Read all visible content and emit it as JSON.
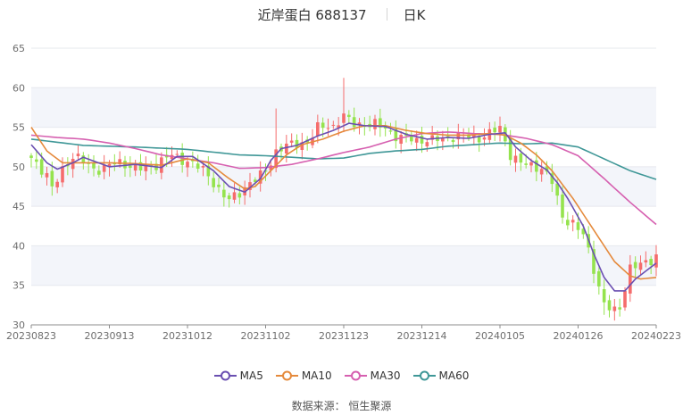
{
  "header": {
    "name_code": "近岸蛋白 688137",
    "period": "日K"
  },
  "source": "数据来源： 恒生聚源",
  "chart_data": {
    "type": "candlestick",
    "y_ticks": [
      30,
      35,
      40,
      45,
      50,
      55,
      60,
      65
    ],
    "ylim": [
      30,
      65
    ],
    "x_tick_labels": [
      "20230823",
      "20230913",
      "20231012",
      "20231102",
      "20231123",
      "20231214",
      "20240105",
      "20240126",
      "20240223"
    ],
    "x_tick_index": [
      0,
      15,
      30,
      45,
      60,
      75,
      90,
      105,
      120
    ],
    "n_days": 121,
    "colors": {
      "up": "#f56c6c",
      "down": "#95e34e",
      "MA5": "#6a4fb1",
      "MA10": "#e58a3c",
      "MA30": "#d660b0",
      "MA60": "#3f9797"
    },
    "legend": [
      "MA5",
      "MA10",
      "MA30",
      "MA60"
    ],
    "close_knots": [
      [
        0,
        50.8
      ],
      [
        3,
        49
      ],
      [
        4,
        47.5
      ],
      [
        6,
        49.8
      ],
      [
        8,
        51
      ],
      [
        12,
        50
      ],
      [
        18,
        50.2
      ],
      [
        24,
        50
      ],
      [
        27,
        51.5
      ],
      [
        30,
        51
      ],
      [
        35,
        48
      ],
      [
        38,
        46
      ],
      [
        40,
        46.5
      ],
      [
        43,
        48.3
      ],
      [
        45,
        49.8
      ],
      [
        47,
        52
      ],
      [
        50,
        52.5
      ],
      [
        53,
        53.5
      ],
      [
        55,
        55
      ],
      [
        58,
        54.8
      ],
      [
        60,
        56.5
      ],
      [
        62,
        55.8
      ],
      [
        65,
        55
      ],
      [
        68,
        55
      ],
      [
        71,
        53.8
      ],
      [
        74,
        53
      ],
      [
        78,
        53.8
      ],
      [
        82,
        53.5
      ],
      [
        86,
        54
      ],
      [
        90,
        54.5
      ],
      [
        92,
        51.5
      ],
      [
        95,
        50.5
      ],
      [
        98,
        49.5
      ],
      [
        100,
        48
      ],
      [
        102,
        44
      ],
      [
        104,
        43
      ],
      [
        106,
        41
      ],
      [
        110,
        33
      ],
      [
        112,
        31.8
      ],
      [
        113,
        32
      ],
      [
        115,
        37
      ],
      [
        118,
        38
      ],
      [
        120,
        39
      ]
    ],
    "ma5_knots": [
      [
        0,
        52.8
      ],
      [
        3,
        50.5
      ],
      [
        5,
        49.7
      ],
      [
        8,
        50.5
      ],
      [
        10,
        51.2
      ],
      [
        15,
        50
      ],
      [
        20,
        50.3
      ],
      [
        25,
        49.9
      ],
      [
        28,
        51.3
      ],
      [
        31,
        51.3
      ],
      [
        35,
        49.5
      ],
      [
        38,
        47.5
      ],
      [
        41,
        46.8
      ],
      [
        44,
        48.5
      ],
      [
        46,
        50.8
      ],
      [
        48,
        52.3
      ],
      [
        51,
        52.7
      ],
      [
        55,
        53.9
      ],
      [
        58,
        54.6
      ],
      [
        61,
        55.5
      ],
      [
        64,
        55.2
      ],
      [
        68,
        55.1
      ],
      [
        72,
        54.1
      ],
      [
        76,
        53.5
      ],
      [
        80,
        53.7
      ],
      [
        84,
        53.6
      ],
      [
        88,
        54.1
      ],
      [
        91,
        54.3
      ],
      [
        93,
        52.5
      ],
      [
        96,
        50.8
      ],
      [
        99,
        49.6
      ],
      [
        101,
        48
      ],
      [
        103,
        46
      ],
      [
        106,
        42.5
      ],
      [
        108,
        39
      ],
      [
        110,
        36
      ],
      [
        112,
        34.3
      ],
      [
        114,
        34.3
      ],
      [
        116,
        35.8
      ],
      [
        120,
        37.8
      ]
    ],
    "ma10_knots": [
      [
        0,
        55
      ],
      [
        3,
        52
      ],
      [
        6,
        50.5
      ],
      [
        10,
        50.5
      ],
      [
        15,
        50.5
      ],
      [
        20,
        50.4
      ],
      [
        25,
        50.2
      ],
      [
        30,
        51
      ],
      [
        34,
        50.5
      ],
      [
        38,
        48.5
      ],
      [
        41,
        47.2
      ],
      [
        43,
        47.5
      ],
      [
        46,
        49.5
      ],
      [
        49,
        51.5
      ],
      [
        52,
        52.8
      ],
      [
        56,
        53.5
      ],
      [
        60,
        54.5
      ],
      [
        64,
        55.2
      ],
      [
        68,
        55.2
      ],
      [
        72,
        54.6
      ],
      [
        76,
        54.2
      ],
      [
        80,
        54
      ],
      [
        84,
        54
      ],
      [
        88,
        54.2
      ],
      [
        91,
        54
      ],
      [
        94,
        53
      ],
      [
        97,
        51.5
      ],
      [
        100,
        49.5
      ],
      [
        104,
        46
      ],
      [
        108,
        42
      ],
      [
        112,
        38
      ],
      [
        115,
        36.2
      ],
      [
        117,
        35.8
      ],
      [
        120,
        36
      ]
    ],
    "ma30_knots": [
      [
        0,
        54
      ],
      [
        5,
        53.7
      ],
      [
        10,
        53.5
      ],
      [
        15,
        53
      ],
      [
        20,
        52.3
      ],
      [
        25,
        51.5
      ],
      [
        30,
        51
      ],
      [
        35,
        50.5
      ],
      [
        40,
        49.8
      ],
      [
        45,
        49.9
      ],
      [
        50,
        50.3
      ],
      [
        55,
        51
      ],
      [
        60,
        51.8
      ],
      [
        65,
        52.5
      ],
      [
        70,
        53.5
      ],
      [
        75,
        54.2
      ],
      [
        80,
        54.4
      ],
      [
        85,
        54.2
      ],
      [
        90,
        54.1
      ],
      [
        95,
        53.6
      ],
      [
        100,
        52.8
      ],
      [
        105,
        51.4
      ],
      [
        110,
        48.5
      ],
      [
        115,
        45.5
      ],
      [
        120,
        42.7
      ]
    ],
    "ma60_knots": [
      [
        0,
        53.5
      ],
      [
        10,
        52.7
      ],
      [
        20,
        52.5
      ],
      [
        30,
        52.2
      ],
      [
        40,
        51.5
      ],
      [
        45,
        51.4
      ],
      [
        50,
        51.2
      ],
      [
        55,
        51
      ],
      [
        60,
        51.1
      ],
      [
        65,
        51.7
      ],
      [
        70,
        52
      ],
      [
        75,
        52.2
      ],
      [
        80,
        52.6
      ],
      [
        85,
        52.8
      ],
      [
        90,
        53
      ],
      [
        95,
        52.9
      ],
      [
        100,
        53
      ],
      [
        105,
        52.5
      ],
      [
        110,
        51
      ],
      [
        115,
        49.5
      ],
      [
        120,
        48.4
      ]
    ]
  }
}
